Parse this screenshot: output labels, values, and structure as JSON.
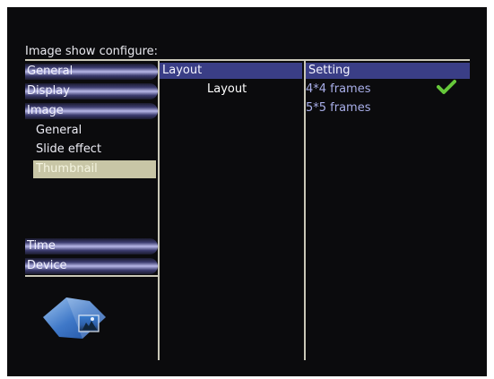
{
  "header": {
    "title": "Image show configure:"
  },
  "sidebar": {
    "categories": [
      {
        "label": "General"
      },
      {
        "label": "Display"
      },
      {
        "label": "Image"
      }
    ],
    "image_subitems": [
      {
        "label": "General"
      },
      {
        "label": "Slide effect"
      },
      {
        "label": "Thumbnail",
        "selected": true
      }
    ],
    "bottom_categories": [
      {
        "label": "Time"
      },
      {
        "label": "Device"
      }
    ]
  },
  "columns": {
    "layout_header": "Layout",
    "setting_header": "Setting",
    "current_item": "Layout"
  },
  "settings": {
    "options": [
      {
        "label": "4*4 frames",
        "checked": true
      },
      {
        "label": "5*5 frames",
        "checked": false
      }
    ]
  },
  "colors": {
    "background": "#0b0b0d",
    "header_bar": "#3a3e86",
    "selection": "#c8c6a6",
    "option_text": "#a8aee8",
    "check": "#66c83a"
  },
  "icons": {
    "check": "check-icon",
    "logo": "photo-frame-logo-icon"
  }
}
